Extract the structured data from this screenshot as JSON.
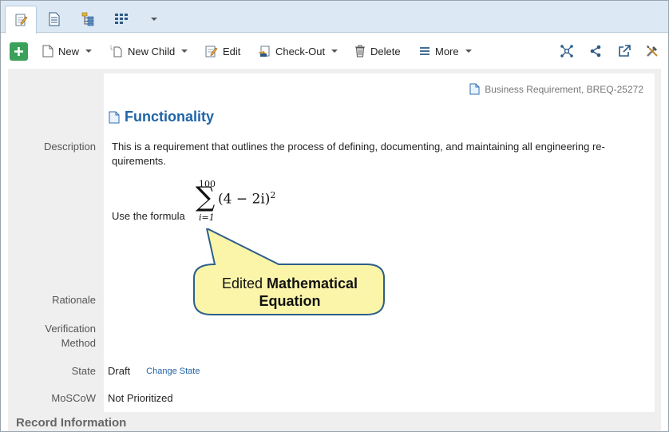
{
  "toolbar": {
    "new_label": "New",
    "new_child_label": "New Child",
    "edit_label": "Edit",
    "checkout_label": "Check-Out",
    "delete_label": "Delete",
    "more_label": "More"
  },
  "record": {
    "type_id": "Business Requirement, BREQ-25272",
    "title": "Functionality"
  },
  "fields": {
    "description_label": "Description",
    "description_text": "This is a requirement that outlines the process of defining, documenting, and maintaining all engineering re-quirements.",
    "formula_prefix": "Use the formula",
    "formula": {
      "upper": "100",
      "lower": "i=1",
      "expression": "(4 − 2i)",
      "exponent": "2"
    },
    "rationale_label": "Rationale",
    "verification_label_1": "Verification",
    "verification_label_2": "Method",
    "state_label": "State",
    "state_value": "Draft",
    "change_state_link": "Change State",
    "moscow_label": "MoSCoW",
    "moscow_value": "Not Prioritized"
  },
  "callout": {
    "line1_prefix": "Edited ",
    "line1_bold": "Mathematical",
    "line2_bold": "Equation"
  },
  "section": {
    "record_info": "Record Information"
  },
  "colors": {
    "accent_blue": "#1f63a8",
    "add_green": "#3aa15a",
    "callout_fill": "#fbf5a9",
    "callout_border": "#2c5f8a"
  }
}
